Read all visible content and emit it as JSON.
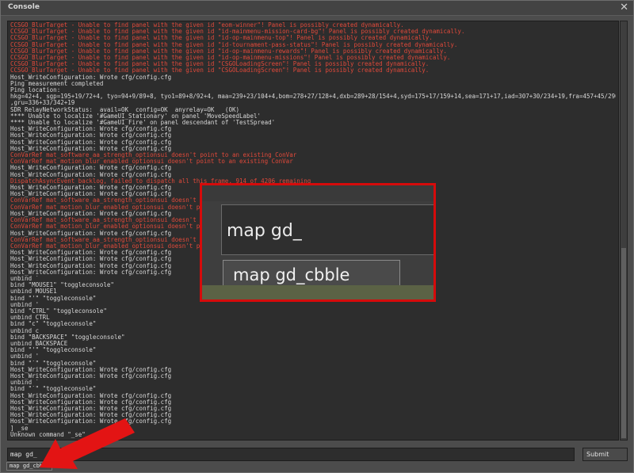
{
  "window": {
    "title": "Console"
  },
  "log": [
    {
      "t": "CCSGO_BlurTarget - Unable to find panel with the given id \"eom-winner\"! Panel is possibly created dynamically.",
      "err": true
    },
    {
      "t": "CCSGO_BlurTarget - Unable to find panel with the given id \"id-mainmenu-mission-card-bg\"! Panel is possibly created dynamically.",
      "err": true
    },
    {
      "t": "CCSGO_BlurTarget - Unable to find panel with the given id \"id-op-mainmenu-top\"! Panel is possibly created dynamically.",
      "err": true
    },
    {
      "t": "CCSGO_BlurTarget - Unable to find panel with the given id \"id-tournament-pass-status\"! Panel is possibly created dynamically.",
      "err": true
    },
    {
      "t": "CCSGO_BlurTarget - Unable to find panel with the given id \"id-op-mainmenu-rewards\"! Panel is possibly created dynamically.",
      "err": true
    },
    {
      "t": "CCSGO_BlurTarget - Unable to find panel with the given id \"id-op-mainmenu-missions\"! Panel is possibly created dynamically.",
      "err": true
    },
    {
      "t": "CCSGO_BlurTarget - Unable to find panel with the given id \"CSGOLoadingScreen\"! Panel is possibly created dynamically.",
      "err": true
    },
    {
      "t": "CCSGO_BlurTarget - Unable to find panel with the given id \"CSGOLoadingScreen\"! Panel is possibly created dynamically.",
      "err": true
    },
    {
      "t": "Host_WriteConfiguration: Wrote cfg/config.cfg",
      "err": false
    },
    {
      "t": "Ping measurement completed",
      "err": false
    },
    {
      "t": "Ping location:",
      "err": false
    },
    {
      "t": "hkg=42+4, sgp=195+19/72+4, tyo=94+9/89+8, tyo1=89+8/92+4, maa=239+23/104+4,bom=278+27/128+4,dxb=289+28/154+4,syd=175+17/159+14,sea=171+17,iad=307+30/234+19,fra=457+45/290+27",
      "err": false
    },
    {
      "t": ",gru=336+33/342+19",
      "err": false
    },
    {
      "t": "SDR RelayNetworkStatus:  avail=OK  config=OK  anyrelay=OK   (OK)",
      "err": false
    },
    {
      "t": "**** Unable to localize '#GameUI_Stationary' on panel 'MoveSpeedLabel'",
      "err": false
    },
    {
      "t": "**** Unable to localize '#GameUI_Fire' on panel descendant of 'TestSpread'",
      "err": false
    },
    {
      "t": "Host_WriteConfiguration: Wrote cfg/config.cfg",
      "err": false
    },
    {
      "t": "Host_WriteConfiguration: Wrote cfg/config.cfg",
      "err": false
    },
    {
      "t": "Host_WriteConfiguration: Wrote cfg/config.cfg",
      "err": false
    },
    {
      "t": "Host_WriteConfiguration: Wrote cfg/config.cfg",
      "err": false
    },
    {
      "t": "ConVarRef mat_software_aa_strength_optionsui doesn't point to an existing ConVar",
      "err": true
    },
    {
      "t": "ConVarRef mat_motion_blur_enabled_optionsui doesn't point to an existing ConVar",
      "err": true
    },
    {
      "t": "Host_WriteConfiguration: Wrote cfg/config.cfg",
      "err": false
    },
    {
      "t": "Host_WriteConfiguration: Wrote cfg/config.cfg",
      "err": false
    },
    {
      "t": "DispatchAsyncEvent backlog, failed to dispatch all this frame. 914 of 4206 remaining",
      "err": true
    },
    {
      "t": "Host_WriteConfiguration: Wrote cfg/config.cfg",
      "err": false
    },
    {
      "t": "Host_WriteConfiguration: Wrote cfg/config.cfg",
      "err": false
    },
    {
      "t": "ConVarRef mat_software_aa_strength_optionsui doesn't p",
      "err": true
    },
    {
      "t": "ConVarRef mat_motion_blur_enabled_optionsui doesn't p",
      "err": true
    },
    {
      "t": "Host_WriteConfiguration: Wrote cfg/config.cfg",
      "err": false
    },
    {
      "t": "ConVarRef mat_software_aa_strength_optionsui doesn't p",
      "err": true
    },
    {
      "t": "ConVarRef mat_motion_blur_enabled_optionsui doesn't p",
      "err": true
    },
    {
      "t": "Host_WriteConfiguration: Wrote cfg/config.cfg",
      "err": false
    },
    {
      "t": "ConVarRef mat_software_aa_strength_optionsui doesn't p",
      "err": true
    },
    {
      "t": "ConVarRef mat_motion_blur_enabled_optionsui doesn't p",
      "err": true
    },
    {
      "t": "Host_WriteConfiguration: Wrote cfg/config.cfg",
      "err": false
    },
    {
      "t": "Host_WriteConfiguration: Wrote cfg/config.cfg",
      "err": false
    },
    {
      "t": "Host_WriteConfiguration: Wrote cfg/config.cfg",
      "err": false
    },
    {
      "t": "Host_WriteConfiguration: Wrote cfg/config.cfg",
      "err": false
    },
    {
      "t": "unbind `",
      "err": false
    },
    {
      "t": "bind \"MOUSE1\" \"toggleconsole\"",
      "err": false
    },
    {
      "t": "unbind MOUSE1",
      "err": false
    },
    {
      "t": "bind \"'\" \"toggleconsole\"",
      "err": false
    },
    {
      "t": "unbind '",
      "err": false
    },
    {
      "t": "bind \"CTRL\" \"toggleconsole\"",
      "err": false
    },
    {
      "t": "unbind CTRL",
      "err": false
    },
    {
      "t": "bind \"c\" \"toggleconsole\"",
      "err": false
    },
    {
      "t": "unbind c",
      "err": false
    },
    {
      "t": "bind \"BACKSPACE\" \"toggleconsole\"",
      "err": false
    },
    {
      "t": "unbind BACKSPACE",
      "err": false
    },
    {
      "t": "bind \"'\" \"toggleconsole\"",
      "err": false
    },
    {
      "t": "unbind '",
      "err": false
    },
    {
      "t": "bind \"`\" \"toggleconsole\"",
      "err": false
    },
    {
      "t": "Host_WriteConfiguration: Wrote cfg/config.cfg",
      "err": false
    },
    {
      "t": "Host_WriteConfiguration: Wrote cfg/config.cfg",
      "err": false
    },
    {
      "t": "unbind `",
      "err": false
    },
    {
      "t": "bind \"`\" \"toggleconsole\"",
      "err": false
    },
    {
      "t": "Host_WriteConfiguration: Wrote cfg/config.cfg",
      "err": false
    },
    {
      "t": "Host_WriteConfiguration: Wrote cfg/config.cfg",
      "err": false
    },
    {
      "t": "Host_WriteConfiguration: Wrote cfg/config.cfg",
      "err": false
    },
    {
      "t": "Host_WriteConfiguration: Wrote cfg/config.cfg",
      "err": false
    },
    {
      "t": "Host_WriteConfiguration: Wrote cfg/config.cfg",
      "err": false
    },
    {
      "t": "] _se",
      "err": false
    },
    {
      "t": "Unknown command \"_se\"",
      "err": false
    }
  ],
  "input": {
    "value": "map gd_"
  },
  "submit_label": "Submit",
  "suggestion": "map gd_cbble",
  "zoom": {
    "input_text": "map gd_",
    "suggestion_text": "map gd_cbble"
  },
  "colors": {
    "error": "#e0493a",
    "highlight": "#d50b0b",
    "arrow": "#e31414"
  }
}
